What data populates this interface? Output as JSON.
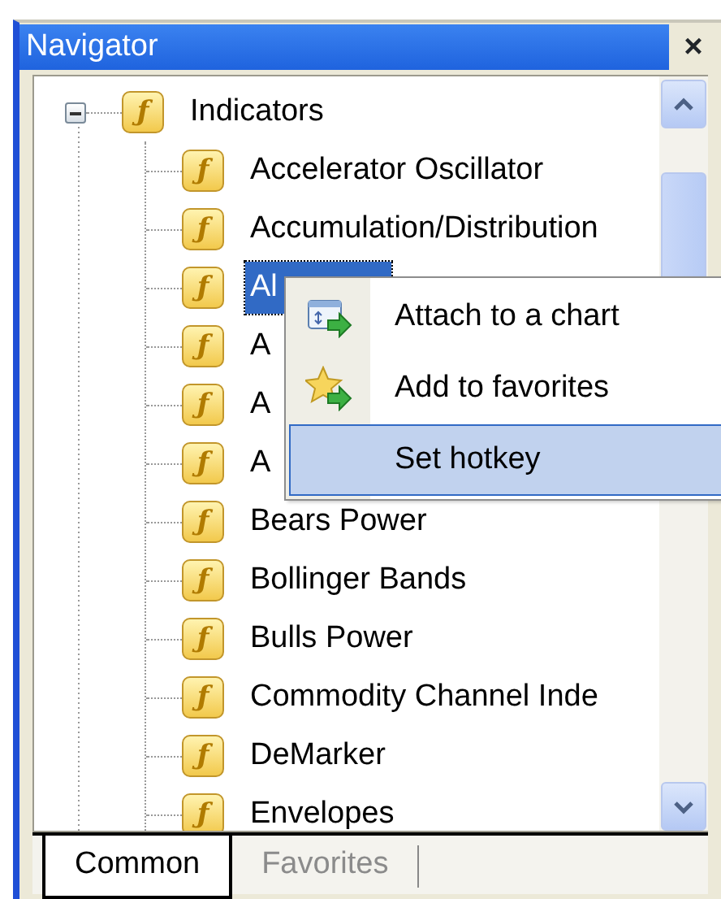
{
  "window": {
    "title": "Navigator",
    "close": "×"
  },
  "tree": [
    {
      "label": "Indicators",
      "icon": "ƒ",
      "expanded": true,
      "selected": false,
      "children": [
        {
          "label": "Accelerator Oscillator",
          "icon": "ƒ",
          "selected": false
        },
        {
          "label": "Accumulation/Distribution",
          "icon": "ƒ",
          "selected": false
        },
        {
          "label": "Al",
          "icon": "ƒ",
          "selected": true
        },
        {
          "label": "A",
          "icon": "ƒ",
          "selected": false
        },
        {
          "label": "A",
          "icon": "ƒ",
          "selected": false
        },
        {
          "label": "A",
          "icon": "ƒ",
          "selected": false
        },
        {
          "label": "Bears Power",
          "icon": "ƒ",
          "selected": false
        },
        {
          "label": "Bollinger Bands",
          "icon": "ƒ",
          "selected": false
        },
        {
          "label": "Bulls Power",
          "icon": "ƒ",
          "selected": false
        },
        {
          "label": "Commodity Channel Inde",
          "icon": "ƒ",
          "selected": false
        },
        {
          "label": "DeMarker",
          "icon": "ƒ",
          "selected": false
        },
        {
          "label": "Envelopes",
          "icon": "ƒ",
          "selected": false
        }
      ]
    }
  ],
  "context_menu": [
    {
      "label": "Attach to a chart",
      "kind": "attach",
      "selected": false
    },
    {
      "label": "Add to favorites",
      "kind": "favorite",
      "selected": false
    },
    {
      "label": "Set hotkey",
      "kind": "plain",
      "selected": true
    }
  ],
  "tabs": [
    {
      "label": "Common",
      "selected": true
    },
    {
      "label": "Favorites",
      "selected": false
    }
  ]
}
